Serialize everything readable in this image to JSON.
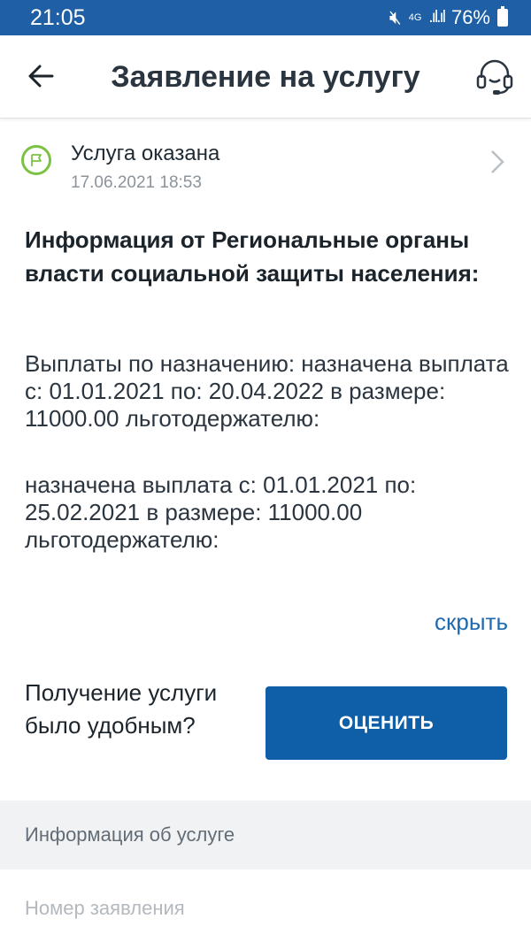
{
  "status_bar": {
    "time": "21:05",
    "network": "4G",
    "battery": "76%"
  },
  "header": {
    "title": "Заявление на услугу",
    "icons": {
      "back": "arrow-left-icon",
      "support": "headset-icon"
    }
  },
  "service_status": {
    "title": "Услуга оказана",
    "date": "17.06.2021 18:53",
    "icon": "flag-icon",
    "accent": "#7cc242"
  },
  "info": {
    "heading": "Информация от Региональные органы власти социальной защиты населения:",
    "payment_1": "Выплаты по назначению: назначена выплата с: 01.01.2021 по: 20.04.2022 в размере: 11000.00 льготодержателю:",
    "payment_2": "назначена выплата с: 01.01.2021 по: 25.02.2021 в размере: 11000.00 льготодержателю:",
    "hide_label": "скрыть"
  },
  "feedback": {
    "question": "Получение услуги было удобным?",
    "rate_label": "ОЦЕНИТЬ",
    "button_color": "#0f5ea8"
  },
  "details": {
    "section_title": "Информация об услуге",
    "application_number_label": "Номер заявления"
  },
  "colors": {
    "status_bar": "#1e5fa6",
    "link": "#1e6ab0"
  }
}
